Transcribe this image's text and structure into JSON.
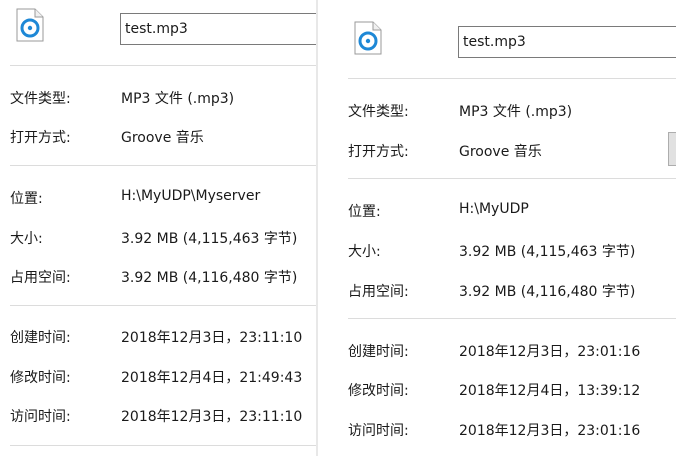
{
  "left": {
    "filename": "test.mp3",
    "labels": {
      "type": "文件类型:",
      "opens_with": "打开方式:",
      "location": "位置:",
      "size": "大小:",
      "size_on_disk": "占用空间:",
      "created": "创建时间:",
      "modified": "修改时间:",
      "accessed": "访问时间:"
    },
    "values": {
      "type": "MP3 文件 (.mp3)",
      "opens_with": "Groove 音乐",
      "location": "H:\\MyUDP\\Myserver",
      "size": "3.92 MB (4,115,463 字节)",
      "size_on_disk": "3.92 MB (4,116,480 字节)",
      "created": "2018年12月3日，23:11:10",
      "modified": "2018年12月4日，21:49:43",
      "accessed": "2018年12月3日，23:11:10"
    }
  },
  "right": {
    "filename": "test.mp3",
    "labels": {
      "type": "文件类型:",
      "opens_with": "打开方式:",
      "location": "位置:",
      "size": "大小:",
      "size_on_disk": "占用空间:",
      "created": "创建时间:",
      "modified": "修改时间:",
      "accessed": "访问时间:"
    },
    "values": {
      "type": "MP3 文件 (.mp3)",
      "opens_with": "Groove 音乐",
      "location": "H:\\MyUDP",
      "size": "3.92 MB (4,115,463 字节)",
      "size_on_disk": "3.92 MB (4,116,480 字节)",
      "created": "2018年12月3日，23:01:16",
      "modified": "2018年12月4日，13:39:12",
      "accessed": "2018年12月3日，23:01:16"
    }
  },
  "icon": {
    "name": "groove-music-file-icon",
    "accent": "#1e88d6"
  }
}
